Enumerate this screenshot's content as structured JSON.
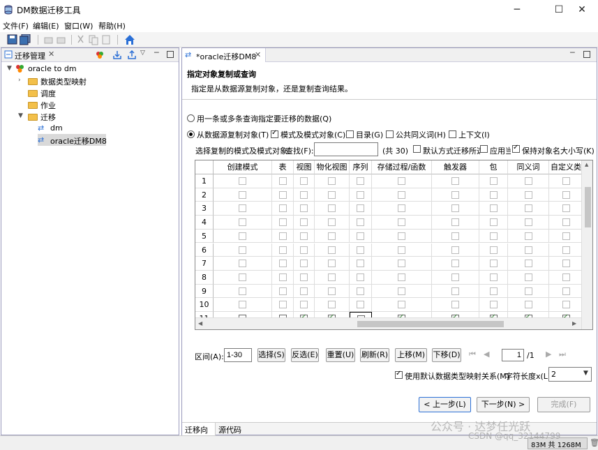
{
  "window": {
    "title": "DM数据迁移工具",
    "minimize": "─",
    "maximize": "☐",
    "close": "✕"
  },
  "menu": [
    "文件(F)",
    "编辑(E)",
    "窗口(W)",
    "帮助(H)"
  ],
  "left_panel": {
    "tab_label": "迁移管理",
    "tree": {
      "root": "oracle  to dm",
      "children": [
        "数据类型映射",
        "调度",
        "作业",
        "迁移"
      ],
      "migration_items": [
        "dm",
        "oracle迁移DM8"
      ]
    }
  },
  "editor": {
    "tab_label": "*oracle迁移DM8",
    "banner_title": "指定对象复制或查询",
    "banner_desc": "指定是从数据源复制对象，还是复制查询结果。",
    "radio_query": "用一条或多条查询指定要迁移的数据(Q)",
    "radio_copy": "从数据源复制对象(T)",
    "check_schema": "模式及模式对象(C)",
    "check_catalog": "目录(G)",
    "check_synonym": "公共同义词(H)",
    "check_context": "上下文(I)",
    "select_label": "选择复制的模式及模式对象:",
    "find_label": "查找(F):",
    "find_value": "",
    "count": "(共 30)",
    "check_default": "默认方式迁移所选",
    "check_apply": "应用当",
    "check_keepcase": "保持对象名大小写(K)",
    "columns": [
      "创建模式",
      "表",
      "视图",
      "物化视图",
      "序列",
      "存储过程/函数",
      "触发器",
      "包",
      "同义词",
      "自定义类"
    ],
    "row_numbers": [
      "1",
      "2",
      "3",
      "4",
      "5",
      "6",
      "7",
      "8",
      "9",
      "10",
      "11"
    ],
    "row11_checked": [
      false,
      false,
      true,
      true,
      false,
      true,
      true,
      true,
      true,
      true
    ],
    "range_label": "区间(A):",
    "range_value": "1-30",
    "btn_select": "选择(S)",
    "btn_invert": "反选(E)",
    "btn_reset": "重置(U)",
    "btn_refresh": "刷新(R)",
    "btn_up": "上移(M)",
    "btn_down": "下移(D)",
    "page_value": "1",
    "page_total": "/1",
    "use_default_mapping": "使用默认数据类型映射关系(M)",
    "char_len_label": "字符长度x(L):",
    "char_len_value": "2",
    "btn_prev": "< 上一步(L)",
    "btn_next": "下一步(N) >",
    "btn_finish": "完成(F)",
    "bottom_tabs": [
      "迁移向导",
      "源代码"
    ]
  },
  "status": {
    "memory": "83M 共 1268M"
  },
  "watermark": "公众号 · 达梦任光跃",
  "watermark2": "CSDN @qq_32144799",
  "colors": {
    "accent": "#2a6fd6",
    "folder": "#f3c04a",
    "check": "#2a7a2a"
  }
}
